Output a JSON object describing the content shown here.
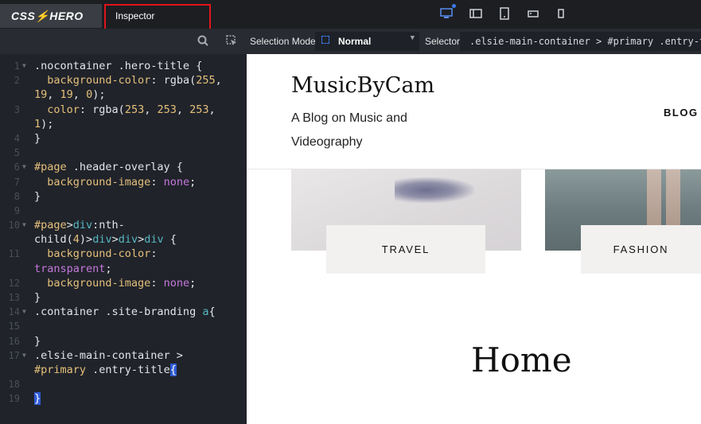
{
  "app": {
    "logo": "CSS⚡HERO",
    "tab_label": "Inspector",
    "device_icons": [
      "desktop-icon",
      "laptop-icon",
      "tablet-icon",
      "tablet-landscape-icon",
      "phone-icon"
    ]
  },
  "left_toolbar": {
    "icons": [
      "search-icon",
      "inspect-icon"
    ]
  },
  "code_lines": [
    {
      "n": "1",
      "fold": true
    },
    {
      "n": "2",
      "fold": false
    },
    {
      "n": "",
      "fold": false
    },
    {
      "n": "3",
      "fold": false
    },
    {
      "n": "",
      "fold": false
    },
    {
      "n": "4",
      "fold": false
    },
    {
      "n": "5",
      "fold": false
    },
    {
      "n": "6",
      "fold": true
    },
    {
      "n": "7",
      "fold": false
    },
    {
      "n": "8",
      "fold": false
    },
    {
      "n": "9",
      "fold": false
    },
    {
      "n": "10",
      "fold": true
    },
    {
      "n": "",
      "fold": false
    },
    {
      "n": "11",
      "fold": false
    },
    {
      "n": "",
      "fold": false
    },
    {
      "n": "12",
      "fold": false
    },
    {
      "n": "13",
      "fold": false
    },
    {
      "n": "14",
      "fold": true
    },
    {
      "n": "15",
      "fold": false
    },
    {
      "n": "16",
      "fold": false
    },
    {
      "n": "17",
      "fold": true
    },
    {
      "n": "",
      "fold": false
    },
    {
      "n": "18",
      "fold": false
    },
    {
      "n": "19",
      "fold": false
    }
  ],
  "toolbar": {
    "selection_mode_label": "Selection Mode",
    "selection_mode_value": "Normal",
    "selector_label": "Selector",
    "selector_value": ".elsie-main-container > #primary .entry-title"
  },
  "site": {
    "title": "MusicByCam",
    "tagline": "A Blog on Music and Videography",
    "nav_item": "BLOG",
    "cards": [
      {
        "label": "TRAVEL"
      },
      {
        "label": "FASHION"
      }
    ],
    "page_title": "Home"
  },
  "colors": {
    "highlight_border": "#e0141b",
    "accent": "#3d7bf2",
    "selector_yellow": "#e5c07b",
    "keyword_purple": "#c678dd",
    "tag_cyan": "#56b6c2"
  }
}
